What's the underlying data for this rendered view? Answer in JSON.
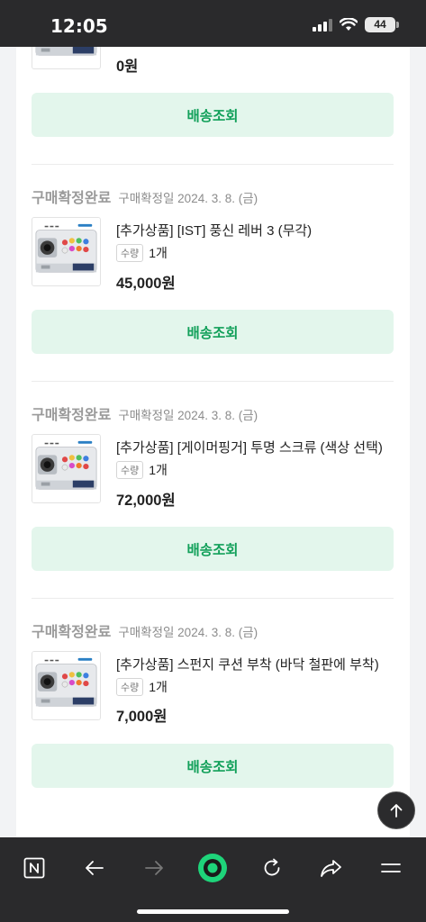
{
  "status_bar": {
    "time": "12:05",
    "battery": "44"
  },
  "top_item": {
    "price": "0원",
    "ship_button": "배송조회"
  },
  "orders": [
    {
      "status": "구매확정완료",
      "date": "구매확정일 2024. 3. 8. (금)",
      "name": "[추가상품] [IST] 풍신 레버 3 (무각)",
      "qty_label": "수량",
      "qty": "1개",
      "price": "45,000원",
      "ship_button": "배송조회"
    },
    {
      "status": "구매확정완료",
      "date": "구매확정일 2024. 3. 8. (금)",
      "name": "[추가상품] [게이머핑거] 투명 스크류 (색상 선택)",
      "qty_label": "수량",
      "qty": "1개",
      "price": "72,000원",
      "ship_button": "배송조회"
    },
    {
      "status": "구매확정완료",
      "date": "구매확정일 2024. 3. 8. (금)",
      "name": "[추가상품] 스펀지 쿠션 부착 (바닥 철판에 부착)",
      "qty_label": "수량",
      "qty": "1개",
      "price": "7,000원",
      "ship_button": "배송조회"
    }
  ],
  "colors": {
    "accent_green": "#12a05a",
    "button_bg": "#e3f6ec",
    "toolbar_bg": "#2a2a2c"
  },
  "toolbar": {
    "icons": [
      "naver-n-icon",
      "back-arrow-icon",
      "forward-arrow-icon",
      "green-dot-icon",
      "refresh-icon",
      "share-icon",
      "menu-icon"
    ]
  }
}
